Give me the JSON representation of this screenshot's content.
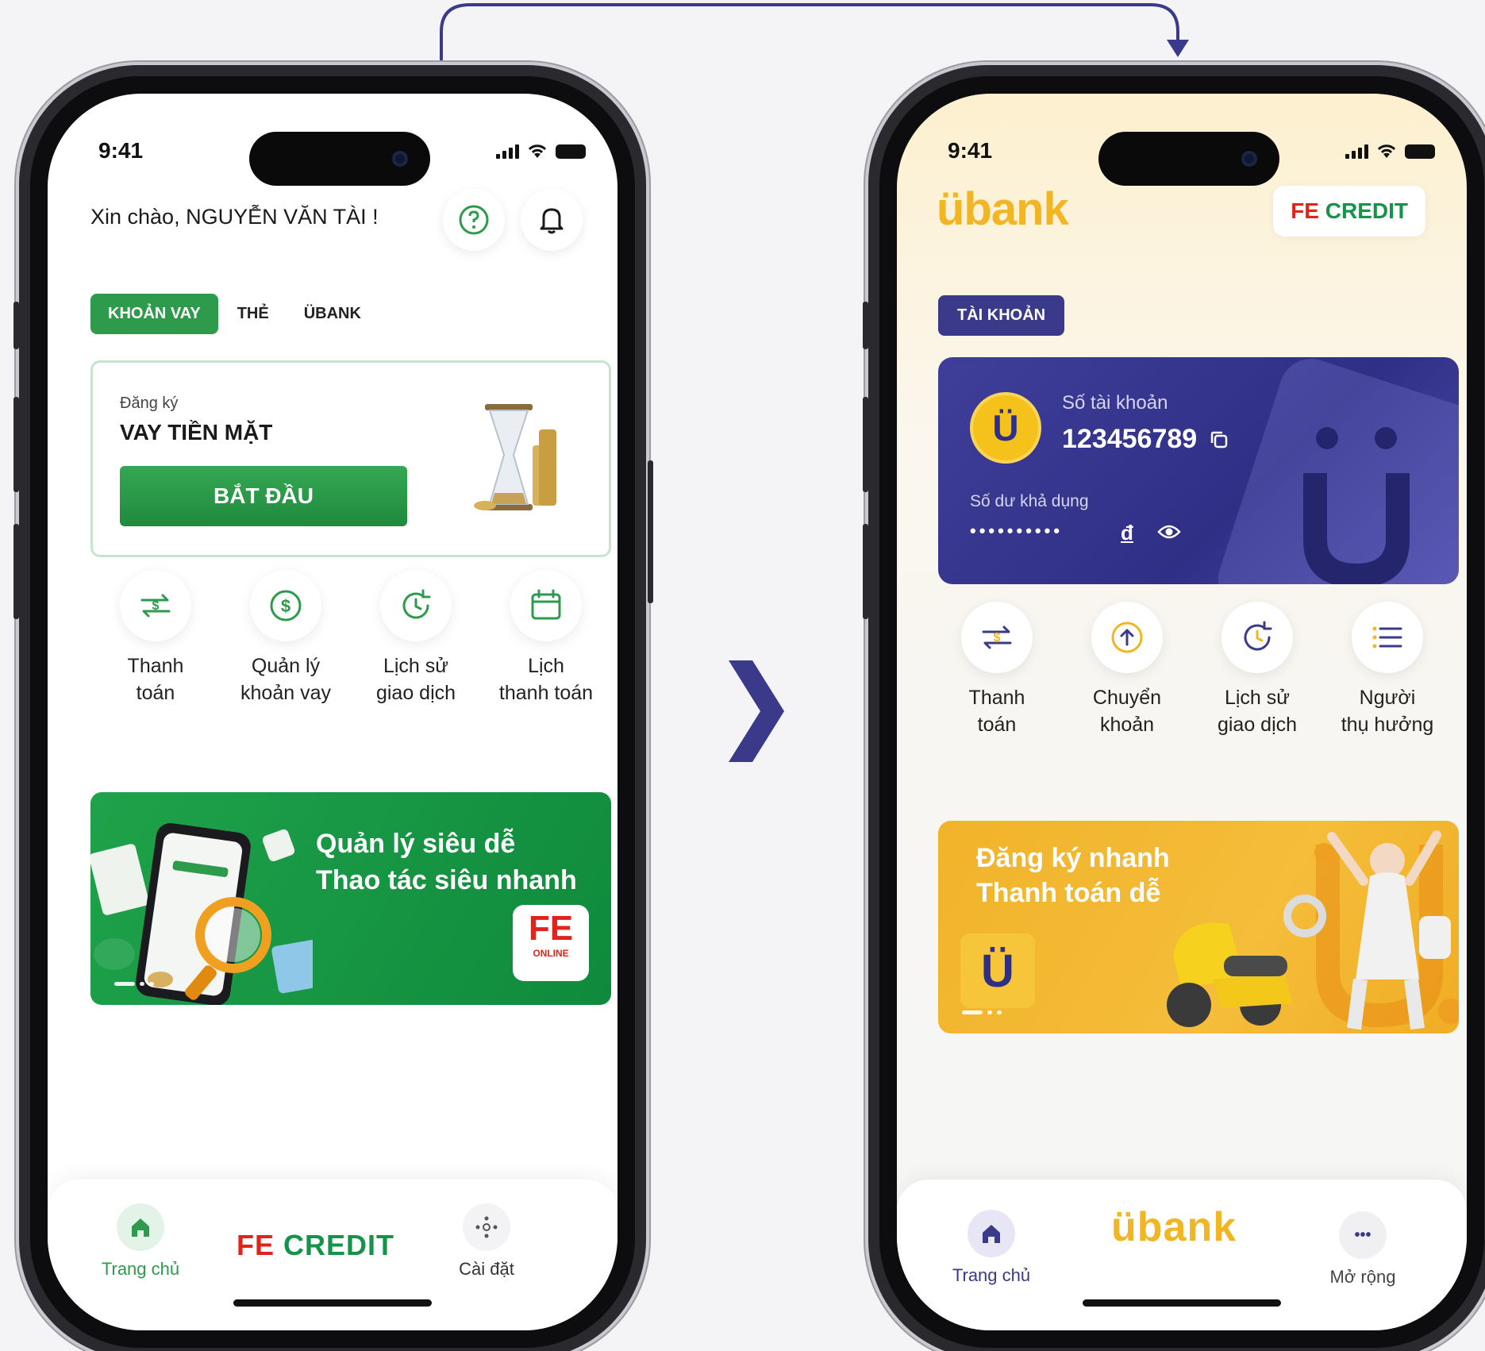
{
  "left": {
    "status": {
      "time": "9:41"
    },
    "greeting": "Xin chào, NGUYỄN VĂN TÀI !",
    "tabs": {
      "active": "KHOẢN VAY",
      "t2": "THẺ",
      "t3": "ÜBANK"
    },
    "loan_card": {
      "subtitle": "Đăng ký",
      "title": "VAY TIỀN MẶT",
      "button": "BẮT ĐẦU"
    },
    "actions": [
      {
        "l1": "Thanh",
        "l2": "toán"
      },
      {
        "l1": "Quản lý",
        "l2": "khoản vay"
      },
      {
        "l1": "Lịch sử",
        "l2": "giao dịch"
      },
      {
        "l1": "Lịch",
        "l2": "thanh toán"
      }
    ],
    "promo": {
      "line1": "Quản lý siêu dễ",
      "line2": "Thao tác siêu nhanh",
      "badge_fe": "FE",
      "badge_online": "ONLINE"
    },
    "nav": {
      "home": "Trang chủ",
      "brand_fe": "FE",
      "brand_credit": "CREDIT",
      "settings": "Cài đặt"
    }
  },
  "right": {
    "status": {
      "time": "9:41"
    },
    "logo": "übank",
    "partner": {
      "fe": "FE",
      "credit": "CREDIT"
    },
    "tab": "TÀI KHOẢN",
    "account": {
      "coin": "Ü",
      "number_label": "Số tài khoản",
      "number": "123456789",
      "balance_label": "Số dư khả dụng",
      "balance_masked": "••••••••••",
      "currency": "đ"
    },
    "actions": [
      {
        "l1": "Thanh",
        "l2": "toán"
      },
      {
        "l1": "Chuyển",
        "l2": "khoản"
      },
      {
        "l1": "Lịch sử",
        "l2": "giao dịch"
      },
      {
        "l1": "Người",
        "l2": "thụ hưởng"
      }
    ],
    "promo": {
      "line1": "Đăng ký nhanh",
      "line2": "Thanh toán dễ",
      "badge": "Ü"
    },
    "nav": {
      "home": "Trang chủ",
      "brand": "übank",
      "more_icon": "•••",
      "more": "Mở rộng"
    }
  },
  "colors": {
    "green": "#2e9a4c",
    "indigo": "#3b3a8a",
    "yellow": "#f2b623",
    "fe_red": "#e2231a",
    "connector": "#3b3a8a"
  }
}
